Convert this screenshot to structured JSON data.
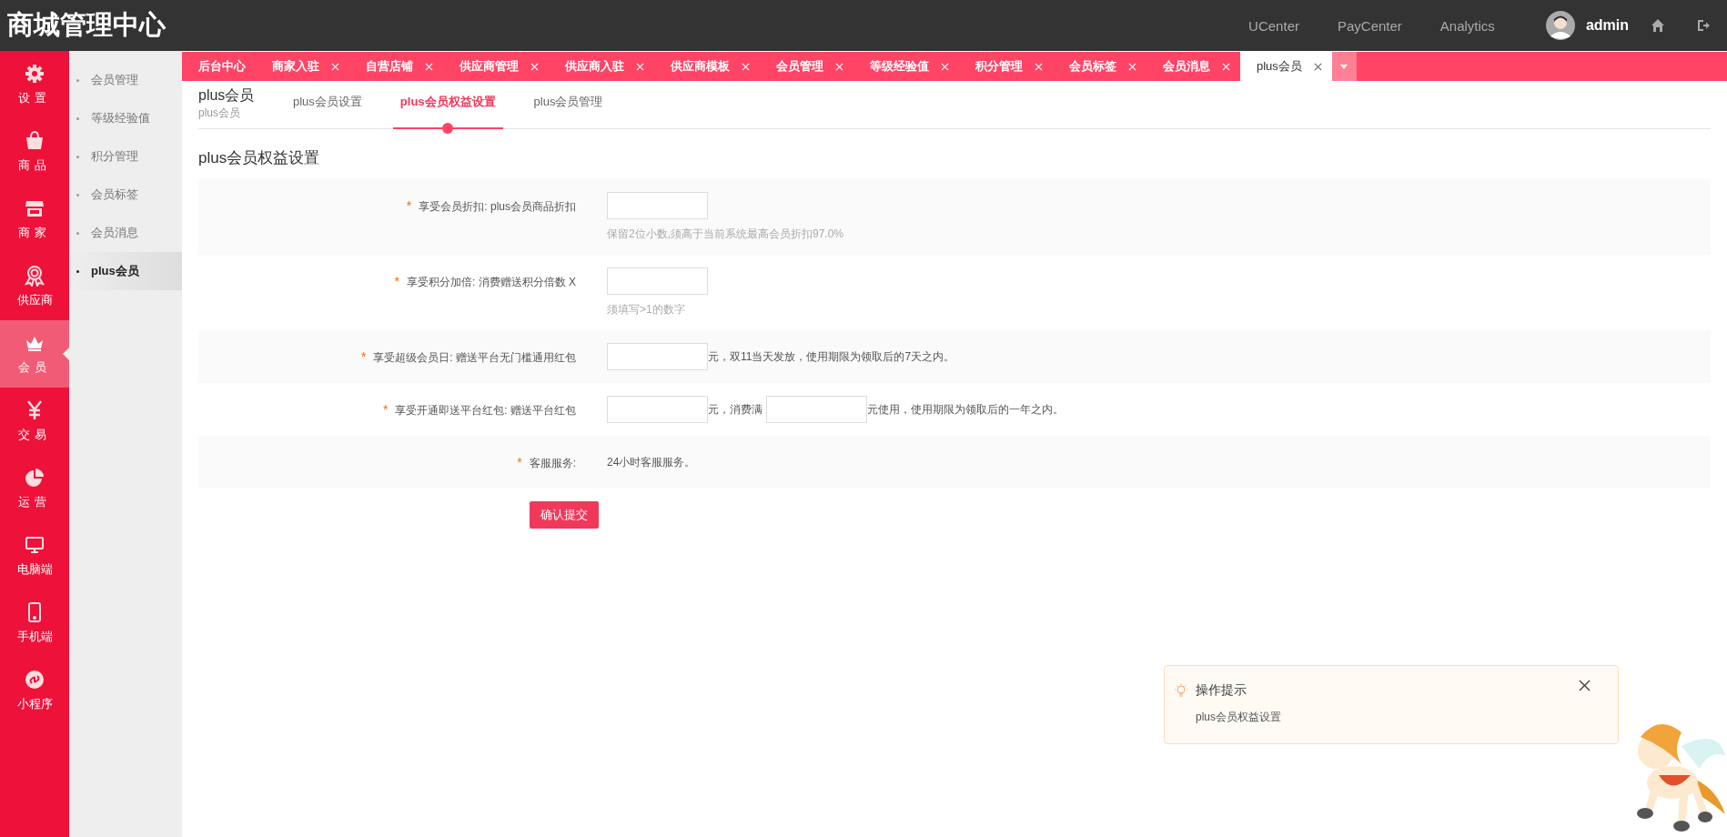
{
  "header": {
    "title": "商城管理中心",
    "links": [
      "UCenter",
      "PayCenter",
      "Analytics"
    ],
    "user": "admin"
  },
  "nav": [
    {
      "label": "设置",
      "selected": false
    },
    {
      "label": "商品",
      "selected": false
    },
    {
      "label": "商家",
      "selected": false
    },
    {
      "label": "供应商",
      "selected": false
    },
    {
      "label": "会员",
      "selected": true
    },
    {
      "label": "交易",
      "selected": false
    },
    {
      "label": "运营",
      "selected": false
    },
    {
      "label": "电脑端",
      "selected": false
    },
    {
      "label": "手机端",
      "selected": false
    },
    {
      "label": "小程序",
      "selected": false
    }
  ],
  "submenu": [
    {
      "label": "会员管理",
      "selected": false
    },
    {
      "label": "等级经验值",
      "selected": false
    },
    {
      "label": "积分管理",
      "selected": false
    },
    {
      "label": "会员标签",
      "selected": false
    },
    {
      "label": "会员消息",
      "selected": false
    },
    {
      "label": "plus会员",
      "selected": true
    }
  ],
  "tabs": [
    {
      "label": "后台中心",
      "closable": false,
      "selected": false
    },
    {
      "label": "商家入驻",
      "closable": true,
      "selected": false
    },
    {
      "label": "自营店铺",
      "closable": true,
      "selected": false
    },
    {
      "label": "供应商管理",
      "closable": true,
      "selected": false
    },
    {
      "label": "供应商入驻",
      "closable": true,
      "selected": false
    },
    {
      "label": "供应商模板",
      "closable": true,
      "selected": false
    },
    {
      "label": "会员管理",
      "closable": true,
      "selected": false
    },
    {
      "label": "等级经验值",
      "closable": true,
      "selected": false
    },
    {
      "label": "积分管理",
      "closable": true,
      "selected": false
    },
    {
      "label": "会员标签",
      "closable": true,
      "selected": false
    },
    {
      "label": "会员消息",
      "closable": true,
      "selected": false
    },
    {
      "label": "plus会员",
      "closable": true,
      "selected": true
    }
  ],
  "page": {
    "title": "plus会员",
    "subtitle": "plus会员",
    "subtabs": [
      {
        "label": "plus会员设置",
        "selected": false
      },
      {
        "label": "plus会员权益设置",
        "selected": true
      },
      {
        "label": "plus会员管理",
        "selected": false
      }
    ]
  },
  "section_title": "plus会员权益设置",
  "form": {
    "rows": [
      {
        "label": "享受会员折扣: plus会员商品折扣",
        "required": true,
        "parts": [
          {
            "kind": "input"
          }
        ],
        "hint": "保留2位小数,须高于当前系统最高会员折扣97.0%"
      },
      {
        "label": "享受积分加倍: 消费赠送积分倍数 X",
        "required": true,
        "parts": [
          {
            "kind": "input"
          }
        ],
        "hint": "须填写>1的数字"
      },
      {
        "label": "享受超级会员日: 赠送平台无门槛通用红包",
        "required": true,
        "parts": [
          {
            "kind": "input"
          },
          {
            "kind": "text",
            "text": "元，双11当天发放，使用期限为领取后的7天之内。"
          }
        ]
      },
      {
        "label": "享受开通即送平台红包: 赠送平台红包",
        "required": true,
        "parts": [
          {
            "kind": "input"
          },
          {
            "kind": "text",
            "text": "元，消费满"
          },
          {
            "kind": "input"
          },
          {
            "kind": "text",
            "text": "元使用，使用期限为领取后的一年之内。"
          }
        ]
      },
      {
        "label": "客服服务:",
        "required": true,
        "parts": [
          {
            "kind": "value",
            "text": "24小时客服服务。"
          }
        ]
      }
    ],
    "required_mark": "*",
    "submit": "确认提交"
  },
  "tip": {
    "title": "操作提示",
    "text": "plus会员权益设置"
  }
}
